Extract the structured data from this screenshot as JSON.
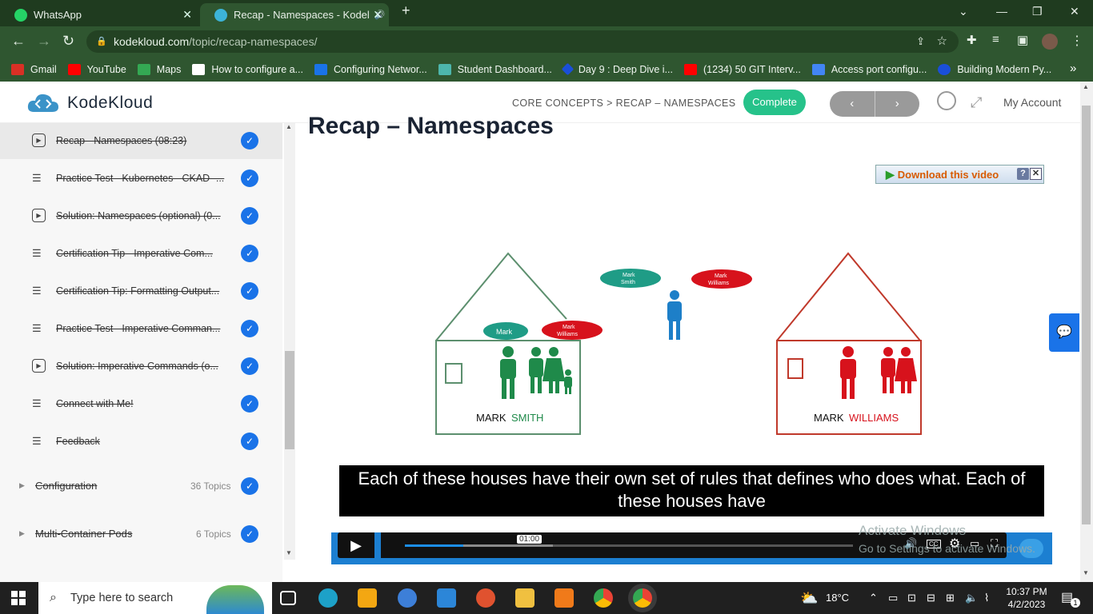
{
  "browser": {
    "tabs": [
      {
        "title": "WhatsApp",
        "close": "✕"
      },
      {
        "title": "Recap - Namespaces - Kodel",
        "close": "✕"
      }
    ],
    "new_tab": "+",
    "url_host": "kodekloud.com",
    "url_path": "/topic/recap-namespaces/",
    "bookmarks": [
      {
        "label": "Gmail",
        "color": "#d93025"
      },
      {
        "label": "YouTube",
        "color": "#ff0000"
      },
      {
        "label": "Maps",
        "color": "#34a853"
      },
      {
        "label": "How to configure a...",
        "color": "#ffffff"
      },
      {
        "label": "Configuring Networ...",
        "color": "#1a73e8"
      },
      {
        "label": "Student Dashboard...",
        "color": "#4db6ac"
      },
      {
        "label": "Day 9 : Deep Dive i...",
        "color": "#1a4fd8"
      },
      {
        "label": "(1234) 50 GIT Interv...",
        "color": "#ff0000"
      },
      {
        "label": "Access port configu...",
        "color": "#4285f4"
      },
      {
        "label": "Building Modern Py...",
        "color": "#1a4fd8"
      }
    ],
    "bookmarks_more": "»"
  },
  "header": {
    "brand": "KodeKloud",
    "breadcrumb": "CORE CONCEPTS > RECAP – NAMESPACES",
    "complete_label": "Complete",
    "prev": "‹",
    "next": "›",
    "account": "My Account"
  },
  "sidebar": {
    "items": [
      {
        "label": "Recap - Namespaces (08:23)",
        "type": "video"
      },
      {
        "label": "Practice Test - Kubernetes - CKAD -...",
        "type": "text"
      },
      {
        "label": "Solution: Namespaces (optional) (0...",
        "type": "video"
      },
      {
        "label": "Certification Tip - Imperative Com...",
        "type": "text"
      },
      {
        "label": "Certification Tip: Formatting Output...",
        "type": "text"
      },
      {
        "label": "Practice Test - Imperative Comman...",
        "type": "text"
      },
      {
        "label": "Solution: Imperative Commands (o...",
        "type": "video"
      },
      {
        "label": "Connect with Me!",
        "type": "text"
      },
      {
        "label": "Feedback",
        "type": "text"
      }
    ],
    "sections": [
      {
        "label": "Configuration",
        "count": "36 Topics"
      },
      {
        "label": "Multi-Container Pods",
        "count": "6 Topics"
      }
    ]
  },
  "main": {
    "title": "Recap – Namespaces",
    "download_label": "Download this video",
    "slide": {
      "house_left_label_a": "MARK",
      "house_left_label_b": "SMITH",
      "house_right_label_a": "MARK",
      "house_right_label_b": "WILLIAMS",
      "bubble_mark": "Mark",
      "bubble_mark_williams_1": "Mark",
      "bubble_mark_williams_2": "Williams",
      "bubble_mark_smith_1": "Mark",
      "bubble_mark_smith_2": "Smith"
    },
    "subtitle": "Each of these houses have their own set of rules that defines who does what. Each of these houses have",
    "player": {
      "time": "01:00",
      "progress": 0.13,
      "buffered": 0.33
    },
    "watermark_title": "Activate Windows",
    "watermark_sub": "Go to Settings to activate Windows."
  },
  "taskbar": {
    "search_placeholder": "Type here to search",
    "weather": "18°C",
    "time": "10:37 PM",
    "date": "4/2/2023",
    "notif_count": "1"
  }
}
